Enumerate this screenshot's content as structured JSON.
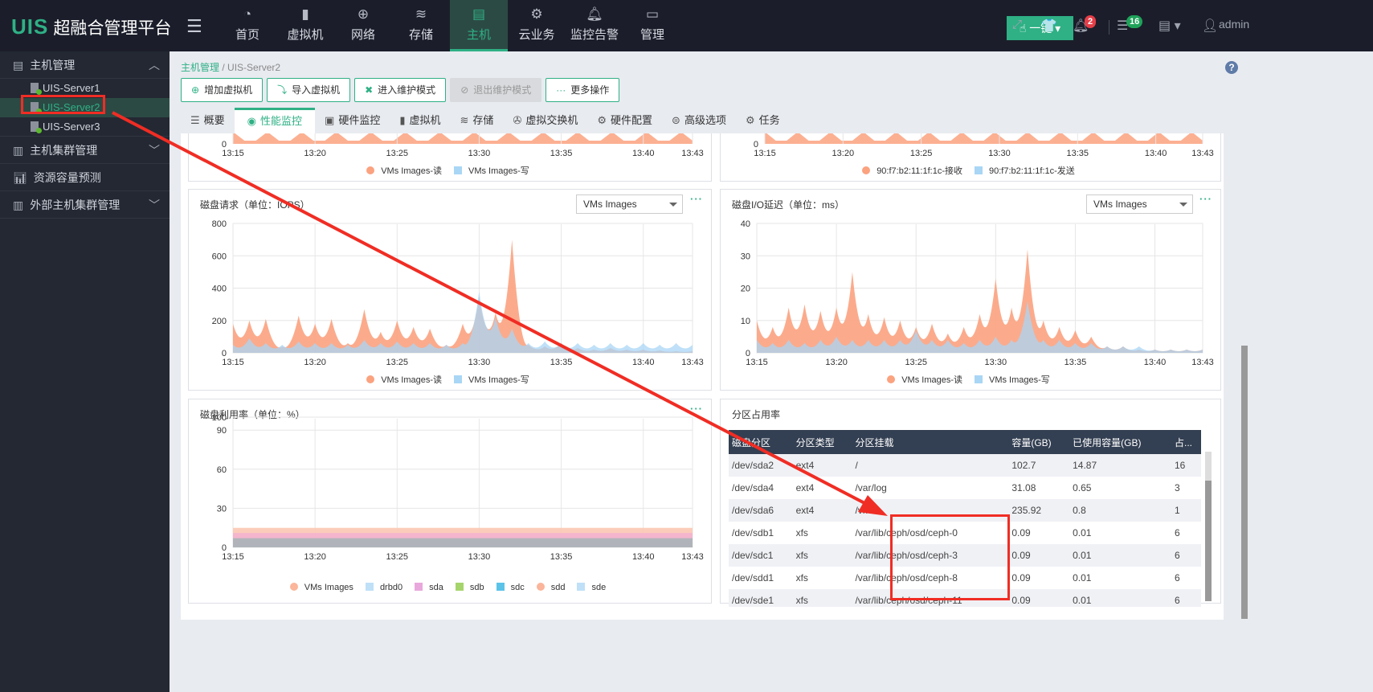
{
  "app": {
    "logo": "UIS",
    "title": "超融合管理平台"
  },
  "nav": [
    {
      "label": "首页",
      "icon": "dashboard-icon"
    },
    {
      "label": "虚拟机",
      "icon": "vm-icon"
    },
    {
      "label": "网络",
      "icon": "globe-icon"
    },
    {
      "label": "存储",
      "icon": "database-icon"
    },
    {
      "label": "主机",
      "icon": "server-icon",
      "active": true
    },
    {
      "label": "云业务",
      "icon": "gear-icon"
    },
    {
      "label": "监控告警",
      "icon": "alarm-icon"
    },
    {
      "label": "管理",
      "icon": "monitor-icon"
    }
  ],
  "topbar": {
    "onekey": "一键",
    "alarm_count": "2",
    "task_count": "16",
    "user": "admin"
  },
  "sidebar": {
    "groups": [
      {
        "label": "主机管理",
        "items": [
          "UIS-Server1",
          "UIS-Server2",
          "UIS-Server3"
        ]
      },
      {
        "label": "主机集群管理"
      },
      {
        "label": "资源容量预测"
      },
      {
        "label": "外部主机集群管理"
      }
    ]
  },
  "breadcrumb": {
    "root": "主机管理",
    "current": "UIS-Server2"
  },
  "toolbar": [
    "增加虚拟机",
    "导入虚拟机",
    "进入维护模式",
    "退出维护模式",
    "更多操作"
  ],
  "tabs": [
    "概要",
    "性能监控",
    "硬件监控",
    "虚拟机",
    "存储",
    "虚拟交换机",
    "硬件配置",
    "高级选项",
    "任务"
  ],
  "colors": {
    "accent": "#2fb085",
    "read": "#fba27f",
    "write": "#a9d6f5",
    "annotation": "#f02d24"
  },
  "time_ticks": [
    "13:15",
    "13:20",
    "13:25",
    "13:30",
    "13:35",
    "13:40",
    "13:43"
  ],
  "top_left_legend": [
    "VMs Images-读",
    "VMs Images-写"
  ],
  "top_right_legend": [
    "90:f7:b2:11:1f:1c-接收",
    "90:f7:b2:11:1f:1c-发送"
  ],
  "chart_data": [
    {
      "type": "area",
      "title": "磁盘请求（单位：IOPS）",
      "selector": "VMs Images",
      "ylim": [
        0,
        800
      ],
      "yticks": [
        0,
        200,
        400,
        600,
        800
      ],
      "x": [
        "13:15",
        "13:16",
        "13:17",
        "13:18",
        "13:19",
        "13:20",
        "13:21",
        "13:22",
        "13:23",
        "13:24",
        "13:25",
        "13:26",
        "13:27",
        "13:28",
        "13:29",
        "13:30",
        "13:31",
        "13:32",
        "13:33",
        "13:34",
        "13:35",
        "13:36",
        "13:37",
        "13:38",
        "13:39",
        "13:40",
        "13:41",
        "13:42",
        "13:43"
      ],
      "series": [
        {
          "name": "VMs Images-读",
          "values": [
            180,
            200,
            210,
            40,
            230,
            180,
            210,
            60,
            270,
            130,
            200,
            160,
            150,
            50,
            180,
            350,
            250,
            700,
            50,
            40,
            60,
            30,
            20,
            30,
            20,
            20,
            15,
            10,
            10
          ]
        },
        {
          "name": "VMs Images-写",
          "values": [
            50,
            90,
            60,
            50,
            70,
            60,
            60,
            50,
            80,
            60,
            70,
            60,
            60,
            50,
            60,
            380,
            220,
            150,
            60,
            70,
            60,
            60,
            50,
            60,
            50,
            60,
            50,
            60,
            50
          ]
        }
      ]
    },
    {
      "type": "area",
      "title": "磁盘I/O延迟（单位：ms）",
      "selector": "VMs Images",
      "ylim": [
        0,
        40
      ],
      "yticks": [
        0,
        10,
        20,
        30,
        40
      ],
      "x": [
        "13:15",
        "13:16",
        "13:17",
        "13:18",
        "13:19",
        "13:20",
        "13:21",
        "13:22",
        "13:23",
        "13:24",
        "13:25",
        "13:26",
        "13:27",
        "13:28",
        "13:29",
        "13:30",
        "13:31",
        "13:32",
        "13:33",
        "13:34",
        "13:35",
        "13:36",
        "13:37",
        "13:38",
        "13:39",
        "13:40",
        "13:41",
        "13:42",
        "13:43"
      ],
      "series": [
        {
          "name": "VMs Images-读",
          "values": [
            10,
            8,
            14,
            15,
            13,
            14,
            25,
            12,
            11,
            10,
            8,
            9,
            6,
            8,
            12,
            23,
            14,
            32,
            10,
            8,
            7,
            5,
            2,
            2,
            1,
            1,
            1,
            1,
            1
          ]
        },
        {
          "name": "VMs Images-写",
          "values": [
            4,
            3,
            4,
            3,
            4,
            5,
            4,
            4,
            4,
            4,
            7,
            4,
            4,
            3,
            4,
            5,
            4,
            16,
            4,
            4,
            3,
            3,
            2,
            2,
            2,
            1,
            1,
            1,
            1
          ]
        }
      ]
    },
    {
      "type": "area",
      "title": "磁盘利用率（单位：%）",
      "ylim": [
        0,
        100
      ],
      "yticks": [
        0,
        30,
        60,
        90,
        100
      ],
      "x": [
        "13:15",
        "13:43"
      ],
      "series": [
        {
          "name": "VMs Images",
          "values": [
            15,
            15
          ]
        },
        {
          "name": "drbd0",
          "values": [
            0,
            0
          ]
        },
        {
          "name": "sda",
          "values": [
            11,
            11
          ]
        },
        {
          "name": "sdb",
          "values": [
            0,
            0
          ]
        },
        {
          "name": "sdc",
          "values": [
            0,
            0
          ]
        },
        {
          "name": "sdd",
          "values": [
            0,
            0
          ]
        },
        {
          "name": "sde",
          "values": [
            7,
            7
          ]
        }
      ]
    }
  ],
  "util_legend": [
    {
      "name": "VMs Images",
      "color": "#fbb59a",
      "shape": "circle"
    },
    {
      "name": "drbd0",
      "color": "#bfe0f7",
      "shape": "square"
    },
    {
      "name": "sda",
      "color": "#e8a8dc",
      "shape": "square"
    },
    {
      "name": "sdb",
      "color": "#a6d46c",
      "shape": "triangle"
    },
    {
      "name": "sdc",
      "color": "#5bc3e8",
      "shape": "diamond"
    },
    {
      "name": "sdd",
      "color": "#fbb59a",
      "shape": "circle"
    },
    {
      "name": "sde",
      "color": "#bfe0f7",
      "shape": "square"
    }
  ],
  "partition": {
    "title": "分区占用率",
    "columns": [
      "磁盘分区",
      "分区类型",
      "分区挂载",
      "容量(GB)",
      "已使用容量(GB)",
      "占..."
    ],
    "rows": [
      [
        "/dev/sda2",
        "ext4",
        "/",
        "102.7",
        "14.87",
        "16"
      ],
      [
        "/dev/sda4",
        "ext4",
        "/var/log",
        "31.08",
        "0.65",
        "3"
      ],
      [
        "/dev/sda6",
        "ext4",
        "/vms",
        "235.92",
        "0.8",
        "1"
      ],
      [
        "/dev/sdb1",
        "xfs",
        "/var/lib/ceph/osd/ceph-0",
        "0.09",
        "0.01",
        "6"
      ],
      [
        "/dev/sdc1",
        "xfs",
        "/var/lib/ceph/osd/ceph-3",
        "0.09",
        "0.01",
        "6"
      ],
      [
        "/dev/sdd1",
        "xfs",
        "/var/lib/ceph/osd/ceph-8",
        "0.09",
        "0.01",
        "6"
      ],
      [
        "/dev/sde1",
        "xfs",
        "/var/lib/ceph/osd/ceph-11",
        "0.09",
        "0.01",
        "6"
      ]
    ]
  }
}
